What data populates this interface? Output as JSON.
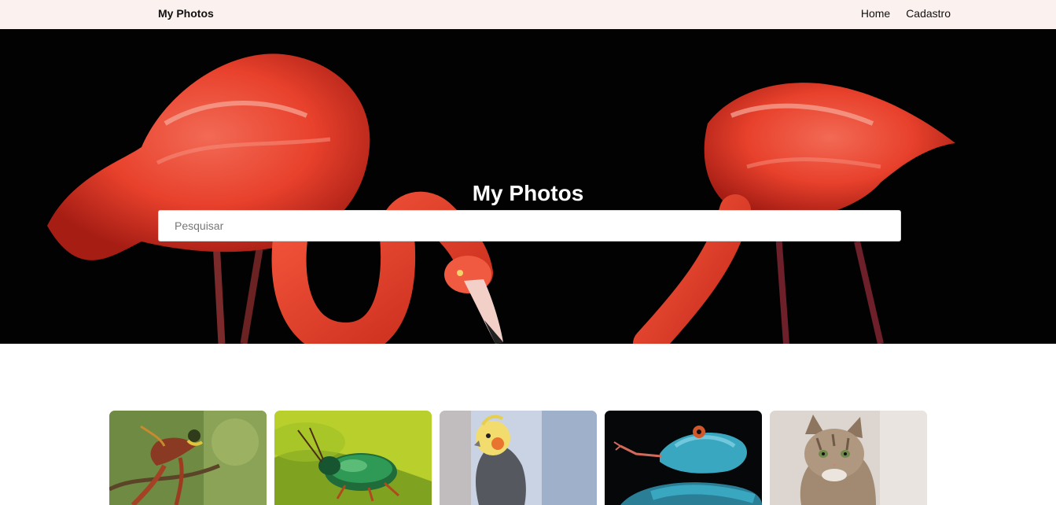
{
  "navbar": {
    "brand": "My Photos",
    "links": [
      "Home",
      "Cadastro"
    ]
  },
  "hero": {
    "title": "My Photos",
    "search_placeholder": "Pesquisar",
    "background_color": "#020202",
    "flamingo_color": "#ee3f2b"
  },
  "gallery": {
    "photos": [
      {
        "subject": "bird-of-paradise-photo"
      },
      {
        "subject": "beetle-photo"
      },
      {
        "subject": "cockatiel-photo"
      },
      {
        "subject": "blue-snake-photo"
      },
      {
        "subject": "cat-photo"
      }
    ]
  },
  "colors": {
    "navbar_bg": "#fbf1ee",
    "text_dark": "#111111"
  }
}
